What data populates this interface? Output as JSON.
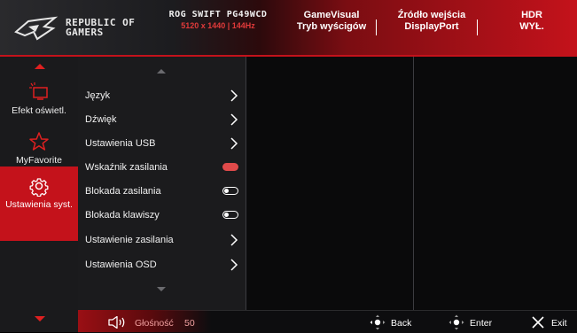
{
  "header": {
    "brand_line1": "REPUBLIC OF",
    "brand_line2": "GAMERS",
    "model_name": "ROG SWIFT PG49WCD",
    "model_res": "5120 x 1440  |  144Hz",
    "sections": [
      {
        "title": "GameVisual",
        "value": "Tryb wyścigów"
      },
      {
        "title": "Źródło wejścia",
        "value": "DisplayPort"
      },
      {
        "title": "HDR",
        "value": "WYŁ."
      }
    ]
  },
  "sidebar": {
    "items": [
      {
        "label": "Efekt oświetl.",
        "icon": "lighting-effect-icon",
        "active": false
      },
      {
        "label": "MyFavorite",
        "icon": "star-icon",
        "active": false
      },
      {
        "label": "Ustawienia syst.",
        "icon": "gear-icon",
        "active": true
      }
    ]
  },
  "menu": {
    "items": [
      {
        "label": "Język",
        "control": "chevron"
      },
      {
        "label": "Dźwięk",
        "control": "chevron"
      },
      {
        "label": "Ustawienia USB",
        "control": "chevron"
      },
      {
        "label": "Wskaźnik zasilania",
        "control": "toggle-on"
      },
      {
        "label": "Blokada zasilania",
        "control": "toggle-off"
      },
      {
        "label": "Blokada klawiszy",
        "control": "toggle-off"
      },
      {
        "label": "Ustawienie zasilania",
        "control": "chevron"
      },
      {
        "label": "Ustawienia OSD",
        "control": "chevron"
      }
    ]
  },
  "footer": {
    "volume_label": "Głośność",
    "volume_value": "50",
    "back_label": "Back",
    "enter_label": "Enter",
    "exit_label": "Exit"
  },
  "colors": {
    "accent": "#c4121b",
    "toggle_on": "#e04a4a"
  }
}
